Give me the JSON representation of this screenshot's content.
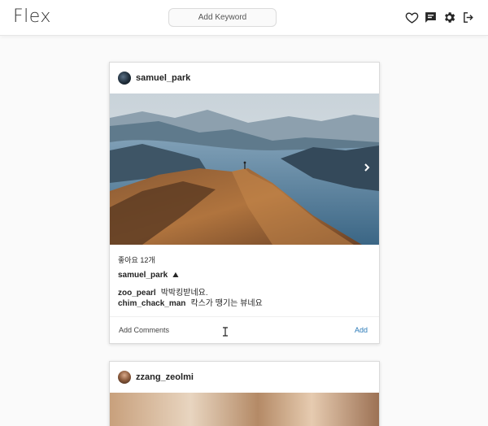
{
  "app": {
    "title": "Flex"
  },
  "search": {
    "placeholder": "Add Keyword"
  },
  "nav_icons": [
    "heart-icon",
    "message-icon",
    "gear-icon",
    "logout-icon"
  ],
  "posts": [
    {
      "username": "samuel_park",
      "likes": "좋아요 12개",
      "caption": {
        "username": "samuel_park",
        "text": "⛰"
      },
      "comments": [
        {
          "user": "zoo_pearl",
          "text": "박박킹받네요."
        },
        {
          "user": "chim_chack_man",
          "text": "칵스가 땡기는 뷰네요"
        }
      ],
      "comment_placeholder": "Add Comments",
      "post_label": "Add"
    },
    {
      "username": "zzang_zeolmi"
    }
  ],
  "colors": {
    "accent": "#2a7ab8",
    "background": "#fafafa",
    "border": "#dbdbdb"
  }
}
